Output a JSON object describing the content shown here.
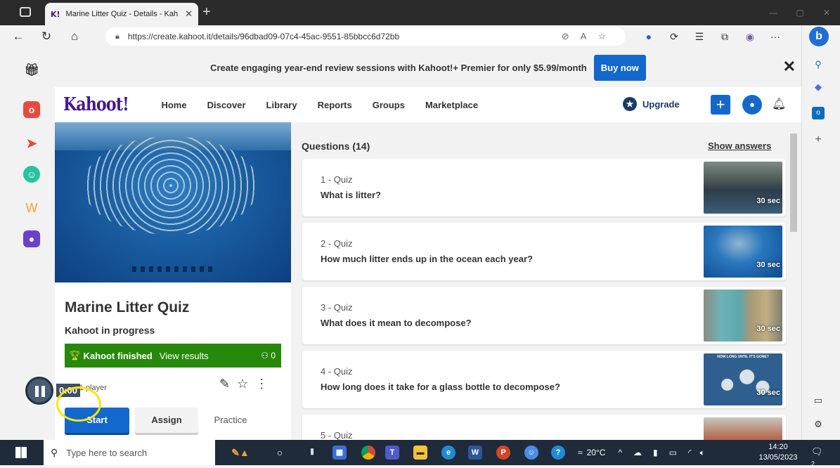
{
  "browser": {
    "tab_title": "Marine Litter Quiz - Details - Kah",
    "tab_favicon": "K!",
    "url": "https://create.kahoot.it/details/96dbad09-07c4-45ac-9551-85bbcc6d72bb"
  },
  "banner": {
    "text": "Create engaging year-end review sessions with Kahoot!+ Premier for only $5.99/month",
    "button": "Buy now"
  },
  "nav": {
    "logo": "Kahoot!",
    "links": [
      "Home",
      "Discover",
      "Library",
      "Reports",
      "Groups",
      "Marketplace"
    ],
    "upgrade": "Upgrade"
  },
  "kahoot": {
    "title": "Marine Litter Quiz",
    "status": "Kahoot in progress",
    "finished_label": "Kahoot finished",
    "view_results": "View results",
    "player_count": "0",
    "meta": "ys · 1 player",
    "start": "Start",
    "assign": "Assign",
    "practice": "Practice"
  },
  "questions": {
    "header": "Questions (14)",
    "show_answers": "Show answers",
    "items": [
      {
        "type": "1 - Quiz",
        "text": "What is litter?",
        "time": "30 sec"
      },
      {
        "type": "2 - Quiz",
        "text": "How much litter ends up in the ocean each year?",
        "time": "30 sec"
      },
      {
        "type": "3 - Quiz",
        "text": "What does it mean to decompose?",
        "time": "30 sec"
      },
      {
        "type": "4 - Quiz",
        "text": "How long does it take for a glass bottle to decompose?",
        "time": "30 sec",
        "thumb_caption": "HOW LONG UNTIL IT'S GONE?"
      },
      {
        "type": "5 - Quiz",
        "text": ""
      }
    ]
  },
  "recorder": {
    "time": "0:00"
  },
  "taskbar": {
    "search_placeholder": "Type here to search",
    "weather": "20°C",
    "time": "14:20",
    "date": "13/05/2023",
    "notifications": "2"
  },
  "colors": {
    "kahoot_purple": "#46178f",
    "primary_blue": "#1368ce",
    "finished_green": "#26890c"
  }
}
